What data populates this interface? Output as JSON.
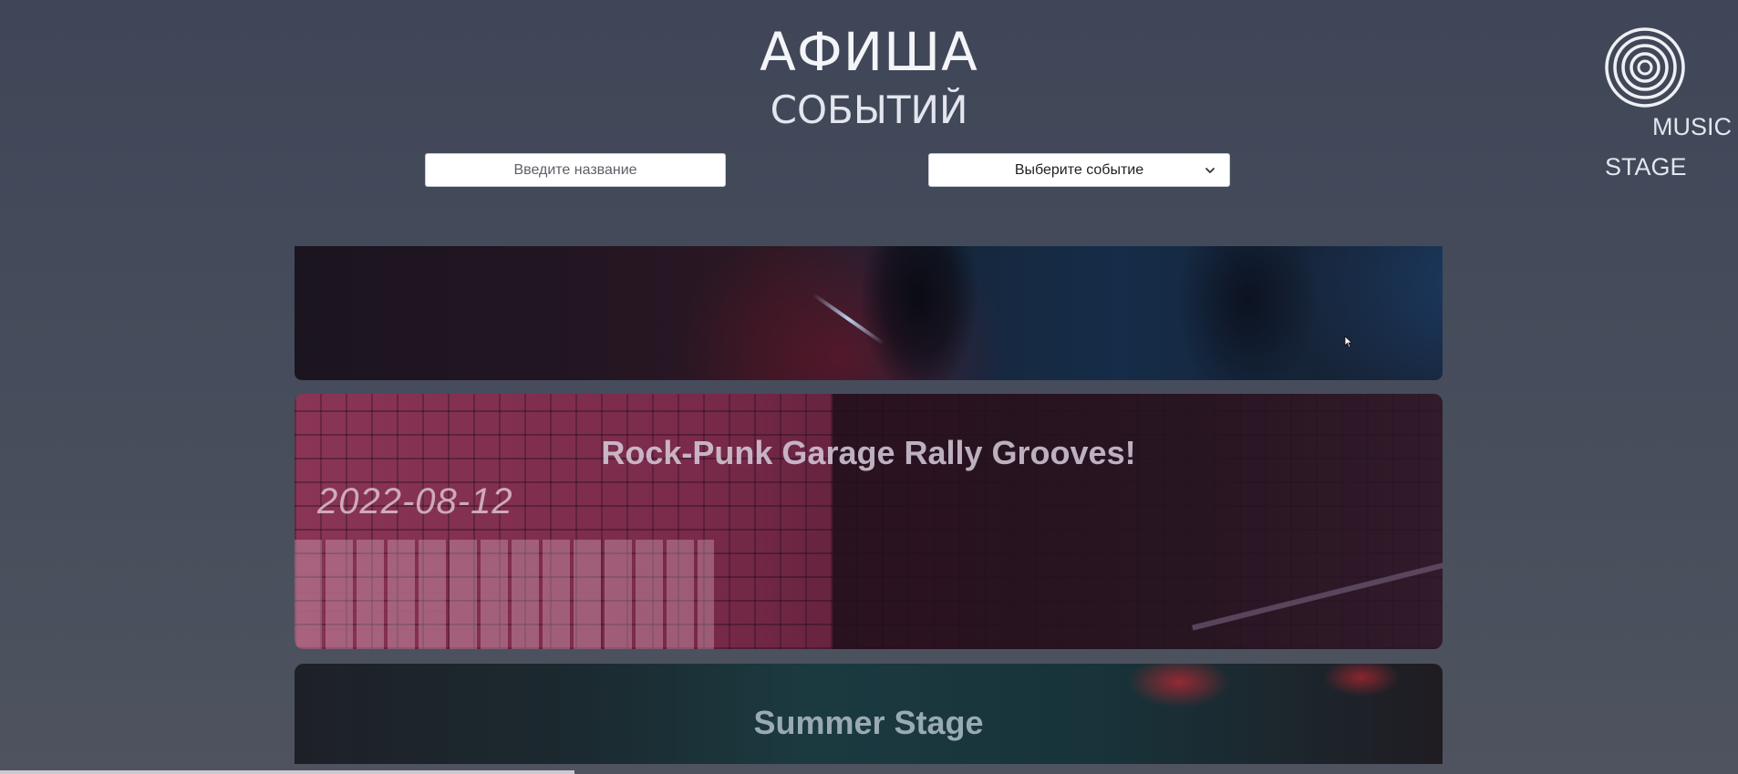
{
  "header": {
    "title": "АФИША",
    "subtitle": "СОБЫТИЙ"
  },
  "filters": {
    "search_placeholder": "Введите название",
    "event_select_label": "Выберите событие"
  },
  "logo": {
    "line1": "MUSIC",
    "line2": "STAGE"
  },
  "events": [
    {
      "title": "",
      "date": ""
    },
    {
      "title": "Rock-Punk Garage Rally Grooves!",
      "date": "2022-08-12"
    },
    {
      "title": "Summer Stage",
      "date": ""
    }
  ],
  "colors": {
    "background": "#434a5a",
    "text": "#f4f5f8"
  }
}
